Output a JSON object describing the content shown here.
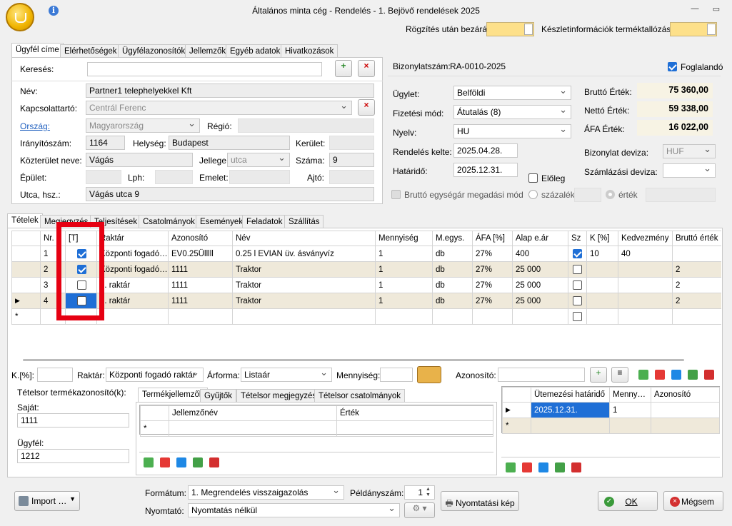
{
  "window": {
    "title": "Általános minta cég - Rendelés - 1. Bejövő rendelések 2025"
  },
  "toptoggles": {
    "close_after": "Rögzítés után bezárás",
    "stock_info": "Készletinformációk terméktallózáskor"
  },
  "customer_tabs": [
    "Ügyfél címe",
    "Elérhetőségek",
    "Ügyfélazonosítók",
    "Jellemzők",
    "Egyéb adatok",
    "Hivatkozások"
  ],
  "customer": {
    "search_label": "Keresés:",
    "name_label": "Név:",
    "name": "Partner1 telephelyekkel Kft",
    "contact_label": "Kapcsolattartó:",
    "contact": "Centrál Ferenc",
    "country_label": "Ország:",
    "country": "Magyarország",
    "region_label": "Régió:",
    "zip_label": "Irányítószám:",
    "zip": "1164",
    "city_label": "Helység:",
    "city": "Budapest",
    "district_label": "Kerület:",
    "street_label": "Közterület neve:",
    "street": "Vágás",
    "type_label": "Jellege:",
    "type": "utca",
    "number_label": "Száma:",
    "number": "9",
    "building_label": "Épület:",
    "stair_label": "Lph:",
    "floor_label": "Emelet:",
    "door_label": "Ajtó:",
    "address_label": "Utca, hsz.:",
    "address": "Vágás utca 9"
  },
  "doc": {
    "number_label": "Bizonylatszám:",
    "number": "RA-0010-2025",
    "reserve_label": "Foglalandó",
    "deal_label": "Ügylet:",
    "deal": "Belföldi",
    "payment_label": "Fizetési mód:",
    "payment": "Átutalás (8)",
    "lang_label": "Nyelv:",
    "lang": "HU",
    "order_date_label": "Rendelés kelte:",
    "order_date": "2025.04.28.",
    "deadline_label": "Határidő:",
    "deadline": "2025.12.31.",
    "advance_label": "Előleg",
    "gross_unit_label": "Bruttó egységár megadási mód",
    "percent_label": "százalék",
    "value_label": "érték",
    "gross_label": "Bruttó Érték:",
    "gross": "75 360,00",
    "net_label": "Nettó Érték:",
    "net": "59 338,00",
    "vat_label": "ÁFA Érték:",
    "vat": "16 022,00",
    "currency_label": "Bizonylat deviza:",
    "currency": "HUF",
    "inv_currency_label": "Számlázási deviza:"
  },
  "main_tabs": [
    "Tételek",
    "Megjegyzés",
    "Teljesítések",
    "Csatolmányok",
    "Események",
    "Feladatok",
    "Szállítás"
  ],
  "items": {
    "columns": [
      "Nr.",
      "[T]",
      "Raktár",
      "Azonosító",
      "Név",
      "Mennyiség",
      "M.egys.",
      "ÁFA [%]",
      "Alap e.ár",
      "Sz",
      "K [%]",
      "Kedvezmény",
      "Bruttó érték"
    ],
    "rows": [
      {
        "nr": "1",
        "wh": "Központi fogadó…",
        "id": "EV0.25Ülllll",
        "name": "0.25 l EVIAN üv. ásványvíz",
        "qty": "1",
        "unit": "db",
        "vat": "27%",
        "price": "400",
        "k": "10",
        "disc": "40",
        "gross": ""
      },
      {
        "nr": "2",
        "wh": "Központi fogadó…",
        "id": "1111",
        "name": "Traktor",
        "qty": "1",
        "unit": "db",
        "vat": "27%",
        "price": "25 000",
        "k": "",
        "disc": "",
        "gross": "2"
      },
      {
        "nr": "3",
        "wh": "5. raktár",
        "id": "1111",
        "name": "Traktor",
        "qty": "1",
        "unit": "db",
        "vat": "27%",
        "price": "25 000",
        "k": "",
        "disc": "",
        "gross": "2"
      },
      {
        "nr": "4",
        "wh": "5. raktár",
        "id": "1111",
        "name": "Traktor",
        "qty": "1",
        "unit": "db",
        "vat": "27%",
        "price": "25 000",
        "k": "",
        "disc": "",
        "gross": "2"
      }
    ]
  },
  "filter": {
    "k_label": "K.[%]:",
    "wh_label": "Raktár:",
    "wh": "Központi fogadó raktár",
    "price_label": "Árforma:",
    "price": "Listaár",
    "qty_label": "Mennyiség:",
    "id_label": "Azonosító:"
  },
  "ident": {
    "title": "Tételsor termékazonosító(k):",
    "own_label": "Saját:",
    "own": "1111",
    "client_label": "Ügyfél:",
    "client": "1212"
  },
  "sub_tabs": [
    "Termékjellemzők",
    "Gyűjtők",
    "Tételsor megjegyzés",
    "Tételsor csatolmányok"
  ],
  "props_cols": [
    "Jellemzőnév",
    "Érték"
  ],
  "sched": {
    "cols": [
      "Ütemezési határidő",
      "Menny…",
      "Azonosító"
    ],
    "date": "2025.12.31.",
    "qty": "1"
  },
  "bottom": {
    "import": "Import …",
    "format_label": "Formátum:",
    "format": "1. Megrendelés visszaigazolás",
    "copies_label": "Példányszám:",
    "copies": "1",
    "printer_label": "Nyomtató:",
    "printer": "Nyomtatás nélkül",
    "preview": "Nyomtatási kép",
    "ok": "OK",
    "cancel": "Mégsem"
  }
}
